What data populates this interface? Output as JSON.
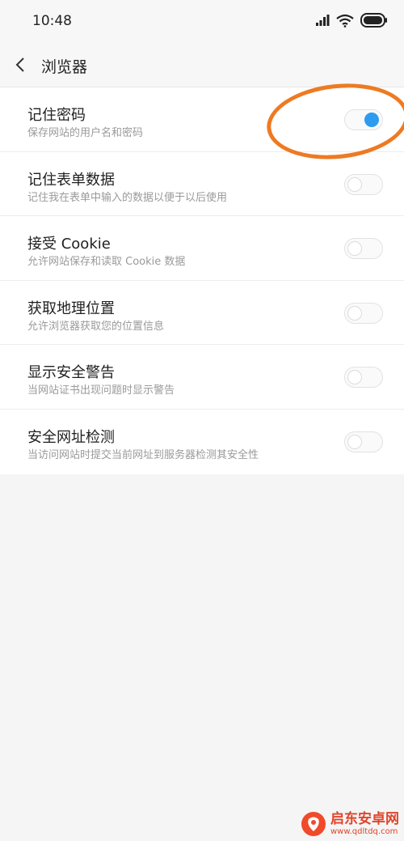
{
  "status_bar": {
    "time": "10:48"
  },
  "nav": {
    "back_icon": "chevron-left-icon",
    "title": "浏览器"
  },
  "settings": [
    {
      "title": "记住密码",
      "description": "保存网站的用户名和密码",
      "enabled": true
    },
    {
      "title": "记住表单数据",
      "description": "记住我在表单中输入的数据以便于以后使用",
      "enabled": false
    },
    {
      "title": "接受 Cookie",
      "description": "允许网站保存和读取 Cookie 数据",
      "enabled": false
    },
    {
      "title": "获取地理位置",
      "description": "允许浏览器获取您的位置信息",
      "enabled": false
    },
    {
      "title": "显示安全警告",
      "description": "当网站证书出现问题时显示警告",
      "enabled": false
    },
    {
      "title": "安全网址检测",
      "description": "当访问网站时提交当前网址到服务器检测其安全性",
      "enabled": false
    }
  ],
  "colors": {
    "toggle_on": "#2d9cf0",
    "highlight": "#ee7a22",
    "watermark": "#e0452a"
  },
  "watermark": {
    "name": "启东安卓网",
    "url": "www.qdltdq.com"
  }
}
